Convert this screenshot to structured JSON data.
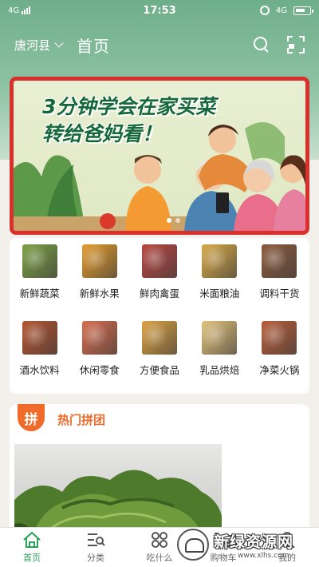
{
  "status_bar": {
    "network_left": "4G",
    "time": "17:53",
    "network_right": "4G"
  },
  "header": {
    "location": "唐河县",
    "title": "首页"
  },
  "banner": {
    "headline_line1": "3分钟学会在家买菜",
    "headline_line2": "转给爸妈看！",
    "slides": 2,
    "active_slide": 1
  },
  "categories": [
    {
      "label": "新鲜蔬菜",
      "icon": "vegetables-icon",
      "color": "#7aa043"
    },
    {
      "label": "新鲜水果",
      "icon": "fruits-icon",
      "color": "#e59b2b"
    },
    {
      "label": "鲜肉禽蛋",
      "icon": "meat-icon",
      "color": "#b9463f"
    },
    {
      "label": "米面粮油",
      "icon": "grain-oil-icon",
      "color": "#d8a946"
    },
    {
      "label": "调料干货",
      "icon": "spices-icon",
      "color": "#8d5a3b"
    },
    {
      "label": "酒水饮料",
      "icon": "drinks-icon",
      "color": "#b4532e"
    },
    {
      "label": "休闲零食",
      "icon": "snacks-icon",
      "color": "#d96b4c"
    },
    {
      "label": "方便食品",
      "icon": "instant-food-icon",
      "color": "#dca241"
    },
    {
      "label": "乳品烘焙",
      "icon": "dairy-bakery-icon",
      "color": "#e3c27a"
    },
    {
      "label": "净菜火锅",
      "icon": "hotpot-icon",
      "color": "#b85c38"
    }
  ],
  "group_buy": {
    "badge": "拼",
    "title": "热门拼团"
  },
  "bottom_nav": [
    {
      "label": "首页",
      "icon": "home-icon",
      "active": true
    },
    {
      "label": "分类",
      "icon": "category-icon",
      "active": false
    },
    {
      "label": "吃什么",
      "icon": "what-to-eat-icon",
      "active": false
    },
    {
      "label": "购物车",
      "icon": "cart-icon",
      "active": false
    },
    {
      "label": "我的",
      "icon": "profile-icon",
      "active": false
    }
  ],
  "watermark": {
    "title": "新绿资源网",
    "url": "www.xlhs.com"
  }
}
